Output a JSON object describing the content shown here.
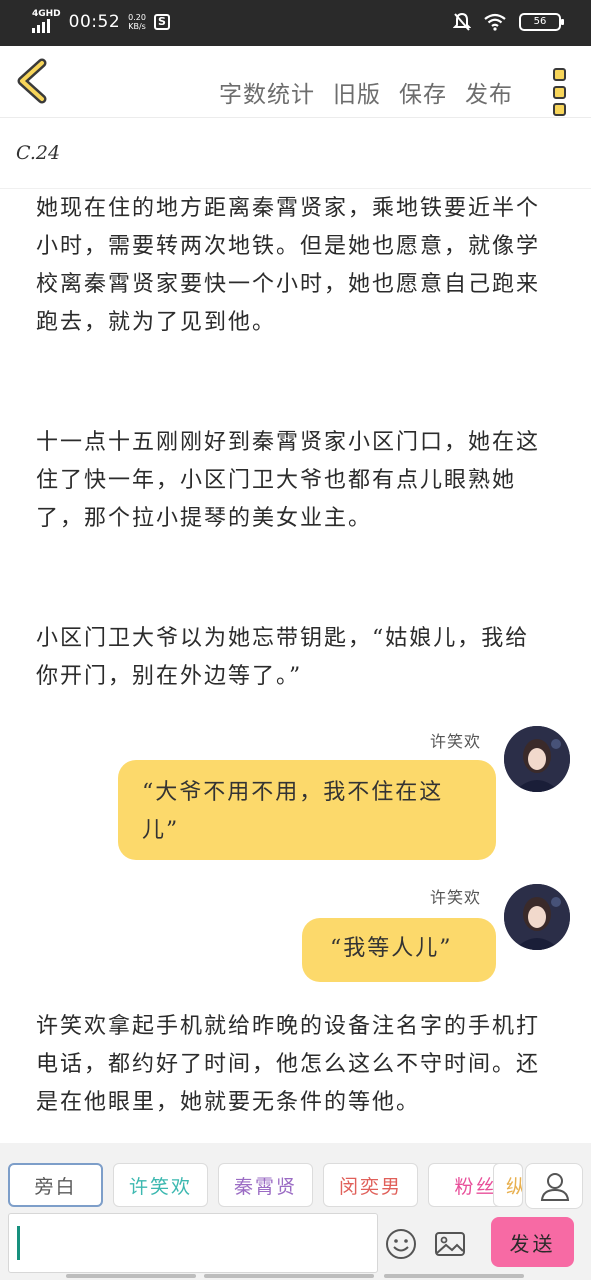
{
  "status_bar": {
    "network": "4GHD",
    "time": "00:52",
    "speed_value": "0.20",
    "speed_unit": "KB/s",
    "app_badge": "S",
    "battery": "56"
  },
  "toolbar": {
    "items": [
      "字数统计",
      "旧版",
      "保存",
      "发布"
    ]
  },
  "chapter": "C.24",
  "paragraphs": [
    "她现在住的地方距离秦霄贤家，乘地铁要近半个小时，需要转两次地铁。但是她也愿意，就像学校离秦霄贤家要快一个小时，她也愿意自己跑来跑去，就为了见到他。",
    "十一点十五刚刚好到秦霄贤家小区门口，她在这住了快一年，小区门卫大爷也都有点儿眼熟她了，那个拉小提琴的美女业主。",
    "小区门卫大爷以为她忘带钥匙，“姑娘儿，我给你开门，别在外边等了。”",
    "许笑欢拿起手机就给昨晚的设备注名字的手机打电话，都约好了时间，他怎么这么不守时间。还是在他眼里，她就要无条件的等他。"
  ],
  "messages": [
    {
      "speaker": "许笑欢",
      "text": "“大爷不用不用，我不住在这儿”"
    },
    {
      "speaker": "许笑欢",
      "text": "“我等人儿”"
    }
  ],
  "roles": [
    {
      "label": "旁白",
      "color": "#5a5a5a"
    },
    {
      "label": "许笑欢",
      "color": "#3cb8b0"
    },
    {
      "label": "秦霄贤",
      "color": "#9b6cc4"
    },
    {
      "label": "闵奕男",
      "color": "#e0605a"
    },
    {
      "label": "粉丝",
      "color": "#e84f9a"
    },
    {
      "label": "纵",
      "color": "#e8b04f"
    }
  ],
  "input": {
    "value": ""
  },
  "send_label": "发送",
  "icons": {
    "back": "back-chevron-icon",
    "more": "more-icon",
    "profile": "user-icon",
    "emoji": "emoji-icon",
    "image": "image-icon"
  }
}
